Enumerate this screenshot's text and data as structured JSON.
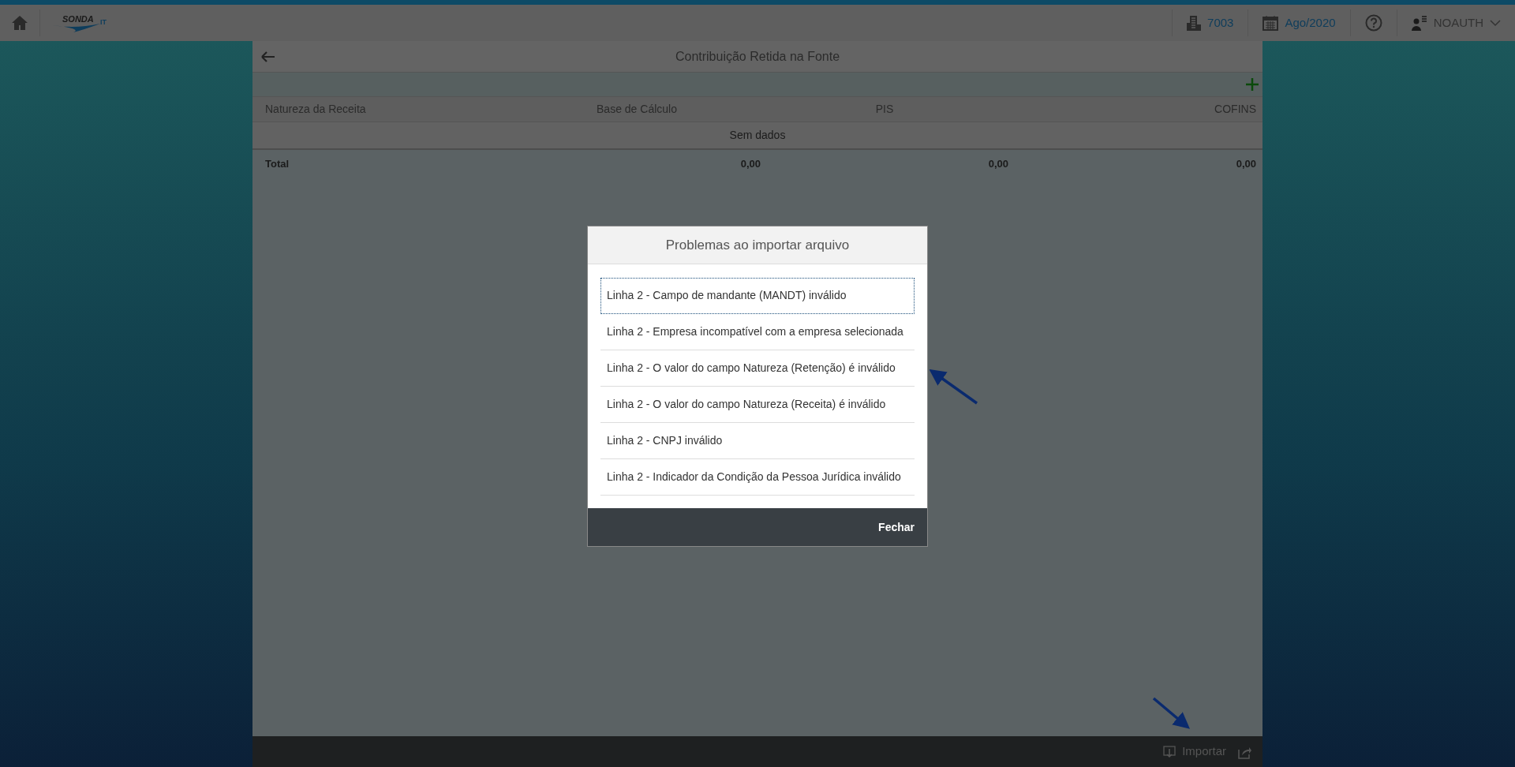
{
  "topbar": {
    "logo": "SONDA",
    "logo_suffix": "IT",
    "company": "7003",
    "period": "Ago/2020",
    "user": "NOAUTH"
  },
  "page": {
    "title": "Contribuição Retida na Fonte",
    "table": {
      "columns": [
        "Natureza da Receita",
        "Base de Cálculo",
        "PIS",
        "COFINS"
      ],
      "empty_message": "Sem dados",
      "total": [
        "Total",
        "0,00",
        "0,00",
        "0,00"
      ]
    }
  },
  "modal": {
    "title": "Problemas ao importar arquivo",
    "items": [
      {
        "text": "Linha 2 - Campo de mandante (MANDT) inválido",
        "selected": true
      },
      {
        "text": "Linha 2 - Empresa incompatível com a empresa selecionada",
        "selected": false
      },
      {
        "text": "Linha 2 - O valor do campo Natureza (Retenção) é inválido",
        "selected": false
      },
      {
        "text": "Linha 2 - O valor do campo Natureza (Receita) é inválido",
        "selected": false
      },
      {
        "text": "Linha 2 - CNPJ inválido",
        "selected": false
      },
      {
        "text": "Linha 2 - Indicador da Condição da Pessoa Jurídica inválido",
        "selected": false
      }
    ],
    "button": "Fechar"
  },
  "footer": {
    "action": "Importar"
  }
}
